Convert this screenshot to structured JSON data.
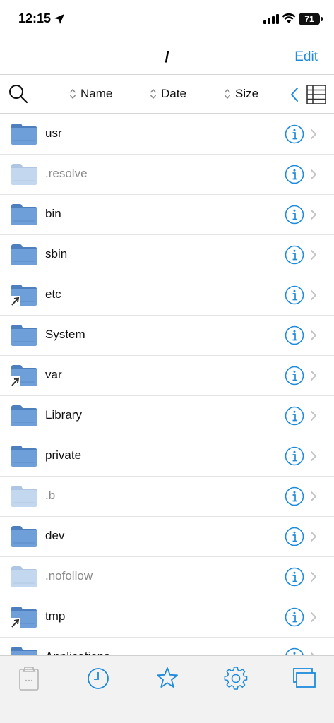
{
  "status_bar": {
    "time": "12:15",
    "battery": "71",
    "location_icon": "location-arrow-icon",
    "signal_icon": "cellular-signal-icon",
    "wifi_icon": "wifi-icon"
  },
  "nav": {
    "title": "/",
    "edit_label": "Edit"
  },
  "sort_bar": {
    "search_icon": "search-icon",
    "name_label": "Name",
    "date_label": "Date",
    "size_label": "Size",
    "back_icon": "chevron-left-icon",
    "view_icon": "list-view-icon"
  },
  "files": [
    {
      "name": "usr",
      "hidden": false,
      "symlink": false
    },
    {
      "name": ".resolve",
      "hidden": true,
      "symlink": false
    },
    {
      "name": "bin",
      "hidden": false,
      "symlink": false
    },
    {
      "name": "sbin",
      "hidden": false,
      "symlink": false
    },
    {
      "name": "etc",
      "hidden": false,
      "symlink": true
    },
    {
      "name": "System",
      "hidden": false,
      "symlink": false
    },
    {
      "name": "var",
      "hidden": false,
      "symlink": true
    },
    {
      "name": "Library",
      "hidden": false,
      "symlink": false
    },
    {
      "name": "private",
      "hidden": false,
      "symlink": false
    },
    {
      "name": ".b",
      "hidden": true,
      "symlink": false
    },
    {
      "name": "dev",
      "hidden": false,
      "symlink": false
    },
    {
      "name": ".nofollow",
      "hidden": true,
      "symlink": false
    },
    {
      "name": "tmp",
      "hidden": false,
      "symlink": true
    },
    {
      "name": "Applications",
      "hidden": false,
      "symlink": false
    }
  ],
  "tab_bar": {
    "tabs": [
      {
        "icon": "clipboard-icon",
        "active": false
      },
      {
        "icon": "clock-icon",
        "active": true
      },
      {
        "icon": "star-icon",
        "active": true
      },
      {
        "icon": "gear-icon",
        "active": true
      },
      {
        "icon": "windows-icon",
        "active": true
      }
    ]
  },
  "colors": {
    "accent": "#1e8bdc",
    "folder": "#6f9fd8",
    "folder_dark": "#4d7fbf",
    "folder_hidden": "#c3d7ee",
    "tab_inactive": "#b5b5b5"
  }
}
